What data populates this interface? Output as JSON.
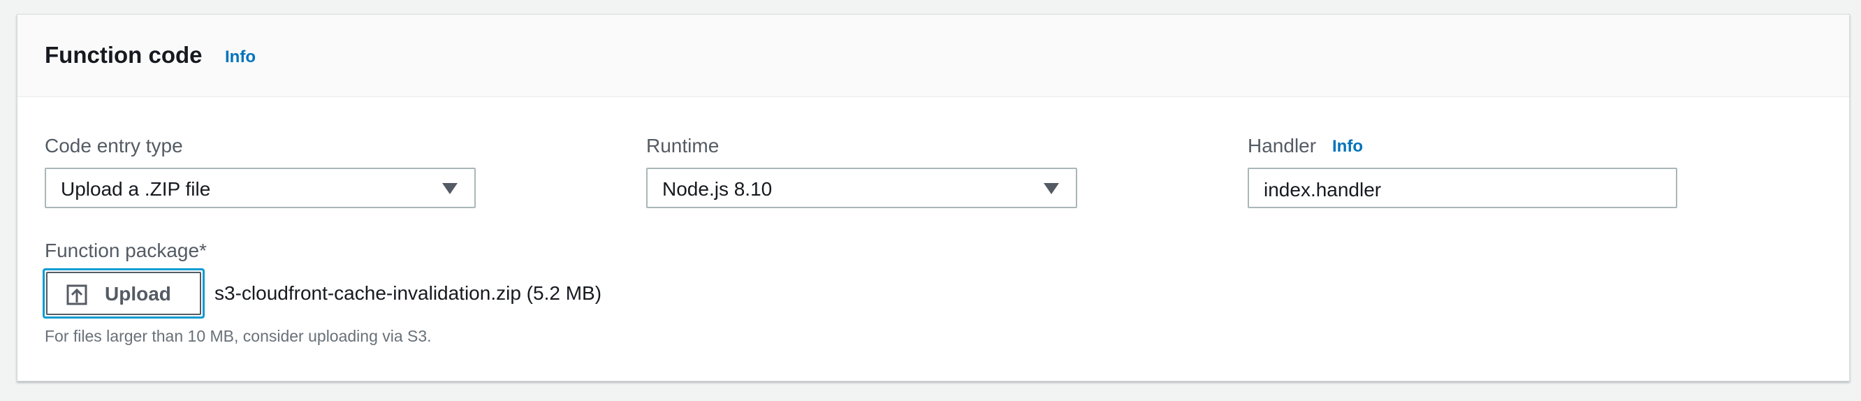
{
  "section": {
    "title": "Function code",
    "info_label": "Info"
  },
  "code_entry_type": {
    "label": "Code entry type",
    "value": "Upload a .ZIP file"
  },
  "runtime": {
    "label": "Runtime",
    "value": "Node.js 8.10"
  },
  "handler": {
    "label": "Handler",
    "info_label": "Info",
    "value": "index.handler"
  },
  "function_package": {
    "label": "Function package*",
    "upload_label": "Upload",
    "filename": "s3-cloudfront-cache-invalidation.zip (5.2 MB)",
    "hint": "For files larger than 10 MB, consider uploading via S3."
  },
  "icons": {
    "upload": "upload-icon",
    "dropdown": "caret-down-icon"
  },
  "colors": {
    "link": "#0073bb",
    "focus_ring": "#0a9bd1",
    "border": "#aab7b8",
    "text": "#16191f",
    "label": "#545b64"
  }
}
